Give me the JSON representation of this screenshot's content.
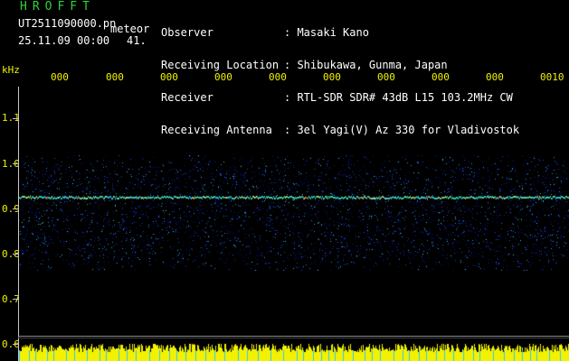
{
  "header": {
    "app_title": "HROFFT",
    "file_name": "UT2511090000.pn",
    "file_suffix": "meteor",
    "timestamp": "25.11.09 00:00",
    "count": "41."
  },
  "info": {
    "labels": [
      "Observer",
      "Receiving Location",
      "Receiver",
      "Receiving Antenna"
    ],
    "values": [
      ": Masaki Kano",
      ": Shibukawa, Gunma, Japan",
      ": RTL-SDR SDR# 43dB L15 103.2MHz CW",
      ": 3el Yagi(V) Az 330 for Vladivostok"
    ]
  },
  "axis": {
    "unit_label": "kHz",
    "time_ticks": [
      "000",
      "000",
      "000",
      "000",
      "000",
      "000",
      "000",
      "000",
      "000",
      "0010"
    ],
    "freq_ticks": [
      "1.1",
      "1.0",
      "0.9",
      "0.8",
      "0.7",
      "0.6"
    ]
  },
  "colors": {
    "title": "#2fd13a",
    "text": "#ffffff",
    "axis_labels": "#f2f200",
    "noise_base": "#0a1a8c",
    "signal_line": "#30d0a0",
    "level_bars": "#f2f200"
  }
}
